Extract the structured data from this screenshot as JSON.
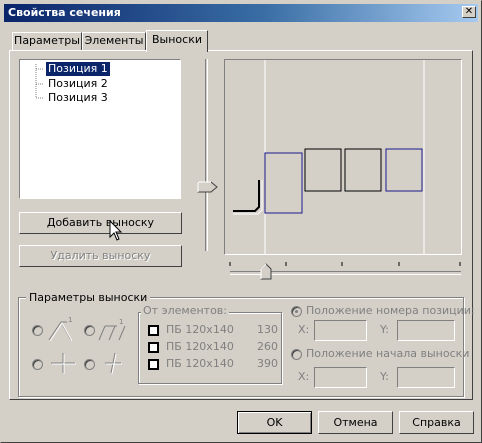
{
  "window": {
    "title": "Свойства сечения"
  },
  "tabs": [
    {
      "label": "Параметры"
    },
    {
      "label": "Элементы"
    },
    {
      "label": "Выноски"
    }
  ],
  "tree": {
    "items": [
      "Позиция 1",
      "Позиция 2",
      "Позиция 3"
    ],
    "selected_index": 0
  },
  "buttons": {
    "add": "Добавить выноску",
    "remove": "Удалить выноску",
    "ok": "OK",
    "cancel": "Отмена",
    "help": "Справка"
  },
  "params_group": {
    "title": "Параметры выноски",
    "from_elements_title": "От элементов:",
    "elements": [
      {
        "name": "ПБ 120х140",
        "value": "130"
      },
      {
        "name": "ПБ 120х140",
        "value": "260"
      },
      {
        "name": "ПБ 120х140",
        "value": "390"
      }
    ],
    "position_number_label": "Положение номера позиции:",
    "leader_start_label": "Положение начала выноски",
    "x_label": "X:",
    "y_label": "Y:"
  },
  "colors": {
    "title_start": "#0a246a",
    "title_end": "#a6caf0",
    "face": "#d4d0c8",
    "selection": "#0a246a",
    "preview_outline": "#1a1a8c"
  }
}
